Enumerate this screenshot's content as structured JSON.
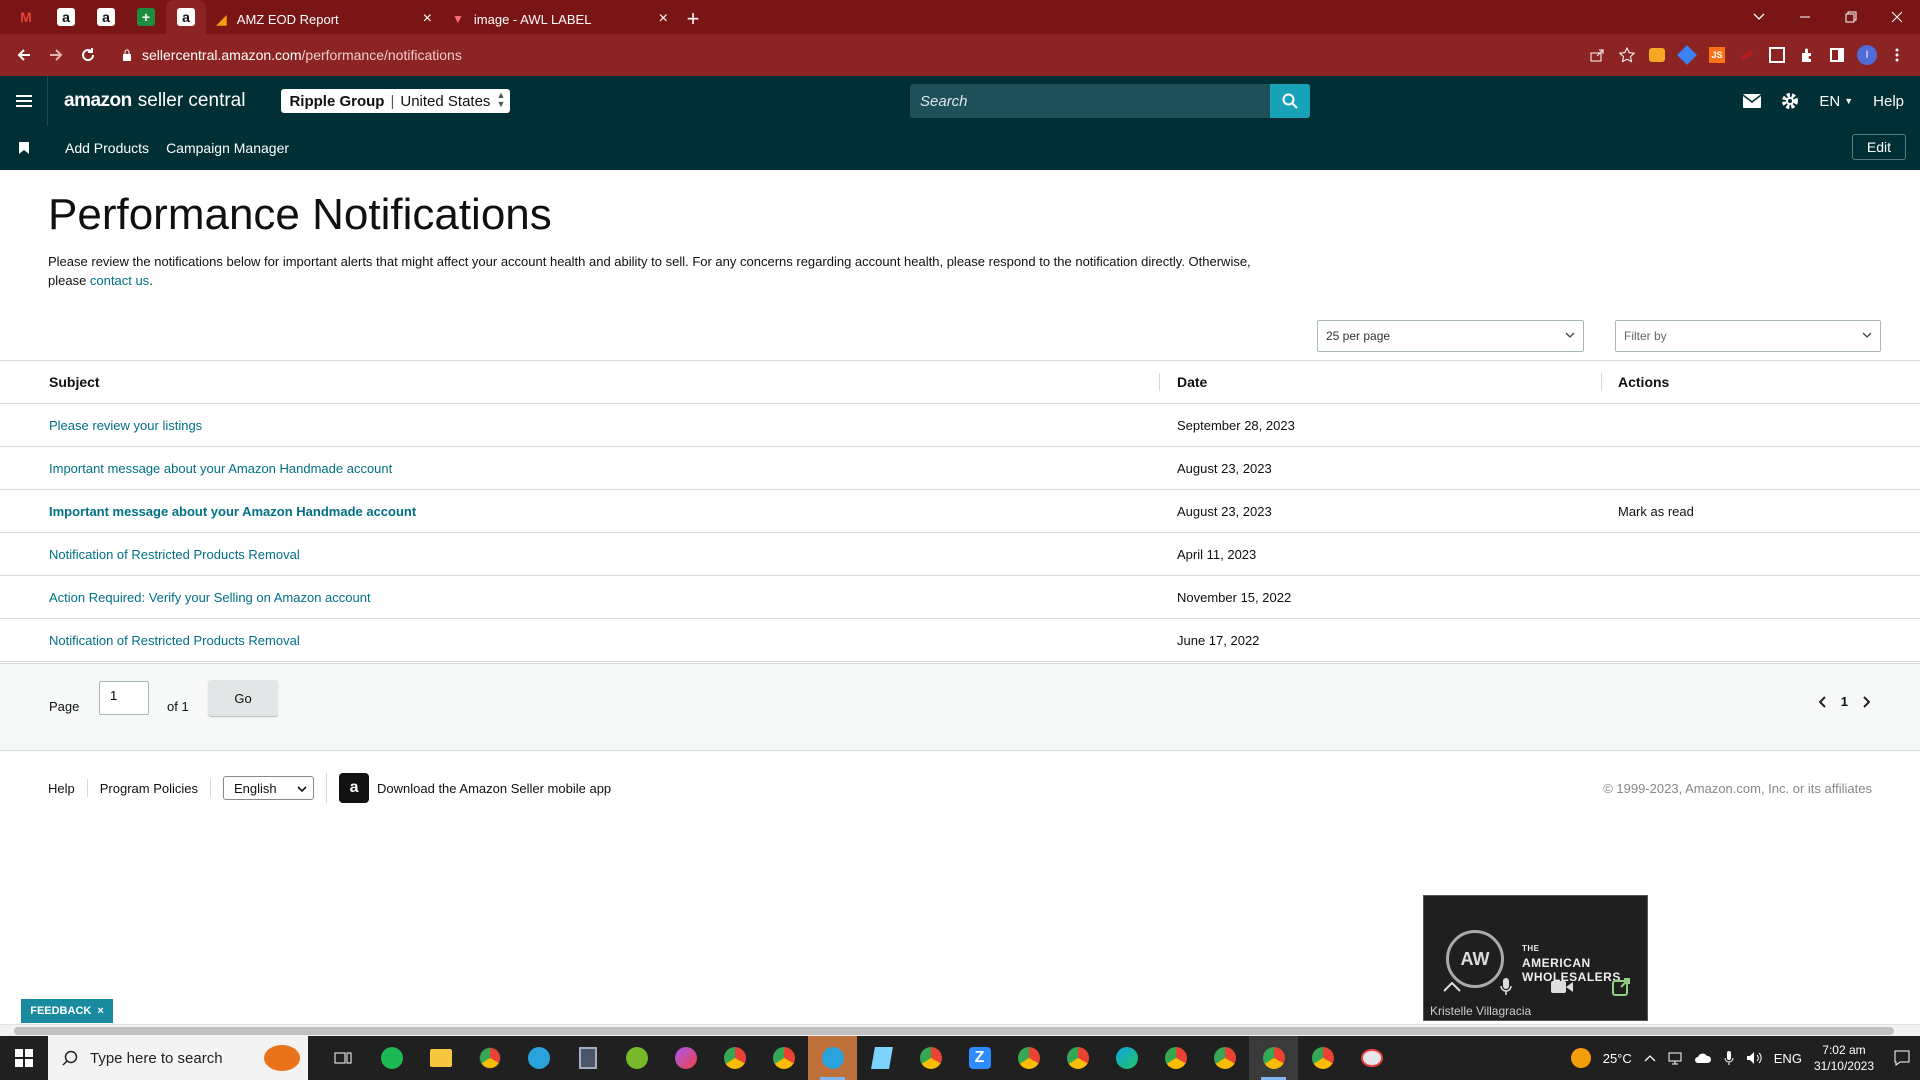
{
  "browser": {
    "tabs": [
      {
        "label": "AMZ EOD Report",
        "active": false
      },
      {
        "label": "image - AWL LABEL",
        "active": false
      }
    ],
    "url": {
      "host": "sellercentral.amazon.com",
      "path": "/performance/notifications"
    }
  },
  "header": {
    "logo_brand": "amazon",
    "logo_product": "seller central",
    "account_name": "Ripple Group",
    "account_region": "United States",
    "search_placeholder": "Search",
    "language": "EN",
    "help": "Help"
  },
  "nav": {
    "items": [
      "Add Products",
      "Campaign Manager"
    ],
    "edit": "Edit"
  },
  "page": {
    "title": "Performance Notifications",
    "intro_text": "Please review the notifications below for important alerts that might affect your account health and ability to sell. For any concerns regarding account health, please respond to the notification directly. Otherwise, please ",
    "intro_link": "contact us",
    "intro_end": "."
  },
  "controls": {
    "per_page": "25 per page",
    "filter": "Filter by"
  },
  "table": {
    "headers": [
      "Subject",
      "Date",
      "Actions"
    ],
    "rows": [
      {
        "subject": "Please review your listings",
        "date": "September 28, 2023",
        "action": "",
        "unread": false
      },
      {
        "subject": "Important message about your Amazon Handmade account",
        "date": "August 23, 2023",
        "action": "",
        "unread": false
      },
      {
        "subject": "Important message about your Amazon Handmade account",
        "date": "August 23, 2023",
        "action": "Mark as read",
        "unread": true
      },
      {
        "subject": "Notification of Restricted Products Removal",
        "date": "April 11, 2023",
        "action": "",
        "unread": false
      },
      {
        "subject": "Action Required: Verify your Selling on Amazon account",
        "date": "November 15, 2022",
        "action": "",
        "unread": false
      },
      {
        "subject": "Notification of Restricted Products Removal",
        "date": "June 17, 2022",
        "action": "",
        "unread": false
      }
    ]
  },
  "pagination": {
    "page_label": "Page",
    "page_value": "1",
    "of_label": "of 1",
    "go": "Go",
    "current": "1"
  },
  "footer": {
    "help": "Help",
    "policies": "Program Policies",
    "language": "English",
    "app": "Download the Amazon Seller mobile app",
    "copyright": "© 1999-2023, Amazon.com, Inc. or its affiliates"
  },
  "feedback": "FEEDBACK",
  "video": {
    "brand_line1": "THE",
    "brand_line2": "AMERICAN",
    "brand_line3": "WHOLESALERS",
    "participant": "Kristelle Villagracia"
  },
  "taskbar": {
    "search_placeholder": "Type here to search",
    "temperature": "25°C",
    "language": "ENG",
    "time": "7:02 am",
    "date": "31/10/2023"
  },
  "colors": {
    "browser_frame": "#7a1515",
    "seller_header": "#002f36",
    "link": "#007185",
    "search_button": "#18a2b8"
  }
}
